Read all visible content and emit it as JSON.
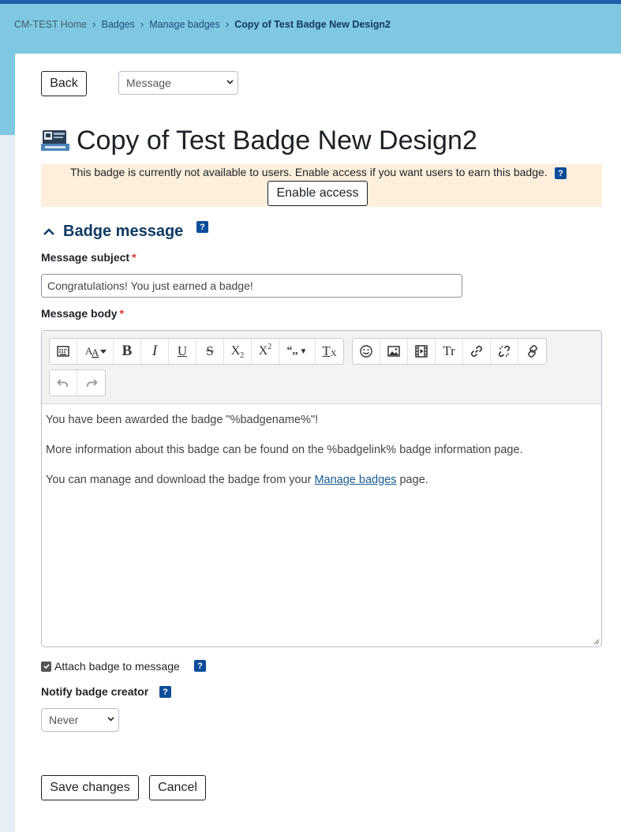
{
  "breadcrumb": [
    {
      "label": "CM-TEST Home"
    },
    {
      "label": "Badges"
    },
    {
      "label": "Manage badges"
    },
    {
      "label": "Copy of Test Badge New Design2"
    }
  ],
  "toolbar": {
    "back_label": "Back",
    "view_select": "Message"
  },
  "page": {
    "title": "Copy of Test Badge New Design2"
  },
  "alert": {
    "text": "This badge is currently not available to users. Enable access if you want users to earn this badge.",
    "button_label": "Enable access"
  },
  "section": {
    "title": "Badge message"
  },
  "form": {
    "subject_label": "Message subject",
    "subject_value": "Congratulations! You just earned a badge!",
    "body_label": "Message body",
    "required_mark": "*",
    "help_mark": "?",
    "body_paragraphs": [
      "You have been awarded the badge \"%badgename%\"!",
      "More information about this badge can be found on the %badgelink% badge information page."
    ],
    "body_para3_before": "You can manage and download the badge from your ",
    "body_para3_link": "Manage badges",
    "body_para3_after": " page.",
    "attach_label": "Attach badge to message",
    "attach_checked": true,
    "notify_label": "Notify badge creator",
    "notify_value": "Never",
    "save_label": "Save changes",
    "cancel_label": "Cancel"
  },
  "editor_buttons": {
    "bold": "B",
    "italic": "I",
    "underline": "U",
    "strike": "S",
    "subscript_base": "X",
    "subscript_index": "2",
    "superscript_base": "X",
    "superscript_index": "2",
    "quote": "“,,",
    "clear_base": "T",
    "clear_index": "X",
    "text_symbol": "Tr"
  },
  "colors": {
    "banner": "#7fc8e1",
    "accent": "#0f3a63",
    "alert_bg": "#fdefdc",
    "help_badge": "#0f4c9a",
    "required": "#d9342b"
  }
}
